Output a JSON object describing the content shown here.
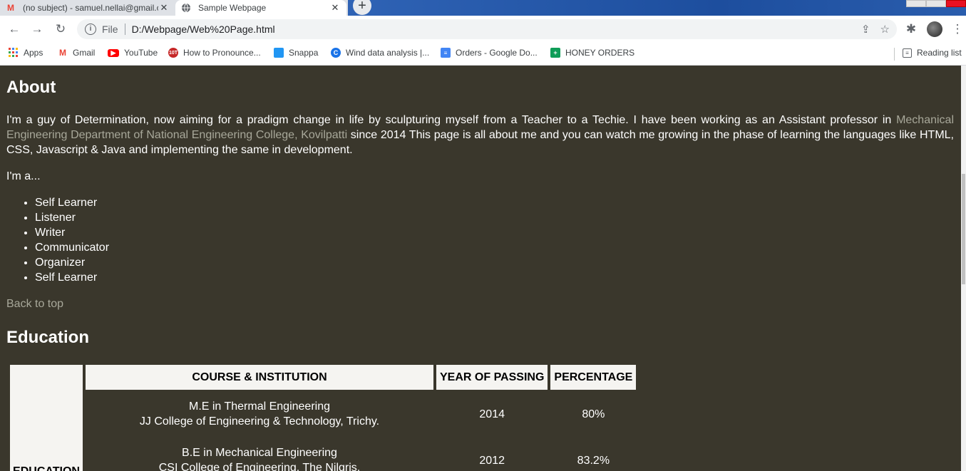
{
  "browser": {
    "tabs": [
      {
        "title": "(no subject) - samuel.nellai@gmail.c",
        "state": "inactive",
        "icon": "gmail-icon"
      },
      {
        "title": "Sample Webpage",
        "state": "active",
        "icon": "globe-icon"
      }
    ],
    "address": {
      "scheme_label": "File",
      "url": "D:/Webpage/Web%20Page.html"
    },
    "bookmarks": [
      {
        "label": "Apps",
        "icon": "apps-grid-icon",
        "color": "#1a73e8"
      },
      {
        "label": "Gmail",
        "icon": "gmail-icon",
        "color": "#ea4335"
      },
      {
        "label": "YouTube",
        "icon": "youtube-icon",
        "color": "#ff0000"
      },
      {
        "label": "How to Pronounce...",
        "icon": "pronounce-icon",
        "color": "#c62828"
      },
      {
        "label": "Snappa",
        "icon": "snappa-icon",
        "color": "#2196f3"
      },
      {
        "label": "Wind data analysis |...",
        "icon": "google-icon",
        "color": "#1a73e8"
      },
      {
        "label": "Orders - Google Do...",
        "icon": "docs-icon",
        "color": "#4285f4"
      },
      {
        "label": "HONEY ORDERS",
        "icon": "sheets-icon",
        "color": "#0f9d58"
      }
    ],
    "reading_list": "Reading list"
  },
  "page": {
    "about": {
      "heading": "About",
      "para_before": "I'm a guy of Determination, now aiming for a pradigm change in life by sculpturing myself from a Teacher to a Techie. I have been working as an Assistant professor in ",
      "para_link": "Mechanical Engineering Department of National Engineering College, Kovilpatti",
      "para_after": " since 2014 This page is all about me and you can watch me growing in the phase of learning the languages like HTML, CSS, Javascript & Java and implementing the same in development.",
      "ima": "I'm a...",
      "traits": [
        "Self Learner",
        "Listener",
        "Writer",
        "Communicator",
        "Organizer",
        "Self Learner"
      ],
      "back_to_top": "Back to top"
    },
    "education": {
      "heading": "Education",
      "side_label": "EDUCATION",
      "headers": [
        "COURSE & INSTITUTION",
        "YEAR OF PASSING",
        "PERCENTAGE"
      ],
      "rows": [
        {
          "course": "M.E in Thermal Engineering",
          "institution": "JJ College of Engineering & Technology, Trichy.",
          "year": "2014",
          "percentage": "80%"
        },
        {
          "course": "B.E in Mechanical Engineering",
          "institution": "CSI College of Engineering, The Nilgris.",
          "year": "2012",
          "percentage": "83.2%"
        }
      ]
    }
  },
  "colors": {
    "page_bg": "#3a372c",
    "link_grey": "#a8a89a",
    "table_header_bg": "#f5f4f1"
  }
}
